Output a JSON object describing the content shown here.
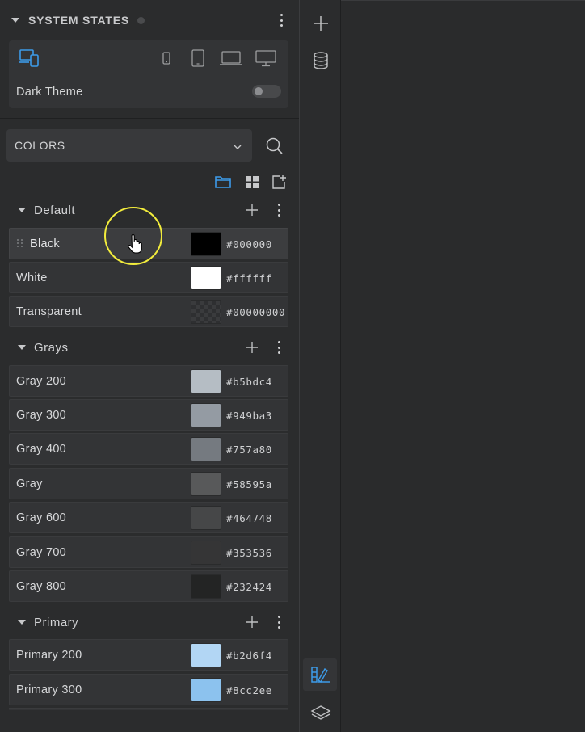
{
  "system_states": {
    "title": "SYSTEM STATES",
    "dark_theme_label": "Dark Theme",
    "dark_theme_on": false,
    "devices": [
      "responsive-icon",
      "phone-small-icon",
      "tablet-icon",
      "laptop-icon",
      "desktop-icon"
    ]
  },
  "palette_select": {
    "value": "COLORS"
  },
  "groups": [
    {
      "name": "Default",
      "colors": [
        {
          "name": "Black",
          "hex": "#000000",
          "swatch": "#000000"
        },
        {
          "name": "White",
          "hex": "#ffffff",
          "swatch": "#ffffff"
        },
        {
          "name": "Transparent",
          "hex": "#00000000",
          "swatch": "transparent"
        }
      ]
    },
    {
      "name": "Grays",
      "colors": [
        {
          "name": "Gray 200",
          "hex": "#b5bdc4",
          "swatch": "#b5bdc4"
        },
        {
          "name": "Gray 300",
          "hex": "#949ba3",
          "swatch": "#949ba3"
        },
        {
          "name": "Gray 400",
          "hex": "#757a80",
          "swatch": "#757a80"
        },
        {
          "name": "Gray",
          "hex": "#58595a",
          "swatch": "#58595a"
        },
        {
          "name": "Gray 600",
          "hex": "#464748",
          "swatch": "#464748"
        },
        {
          "name": "Gray 700",
          "hex": "#353536",
          "swatch": "#353536"
        },
        {
          "name": "Gray 800",
          "hex": "#232424",
          "swatch": "#232424"
        }
      ]
    },
    {
      "name": "Primary",
      "colors": [
        {
          "name": "Primary 200",
          "hex": "#b2d6f4",
          "swatch": "#b2d6f4"
        },
        {
          "name": "Primary 300",
          "hex": "#8cc2ee",
          "swatch": "#8cc2ee"
        }
      ]
    }
  ],
  "accent": "#3d9be9"
}
